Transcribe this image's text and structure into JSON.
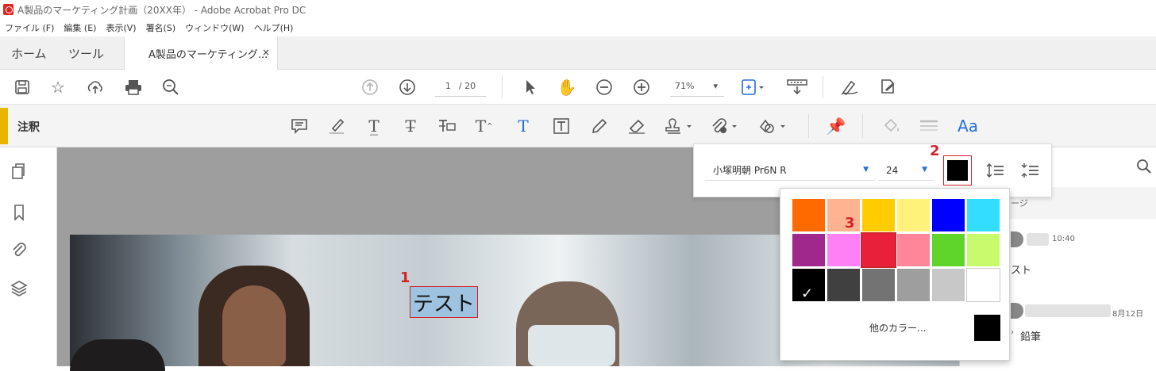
{
  "window": {
    "title": "A製品のマーケティング計画（20XX年） - Adobe Acrobat Pro DC"
  },
  "menu": [
    "ファイル (F)",
    "編集 (E)",
    "表示(V)",
    "署名(S)",
    "ウィンドウ(W)",
    "ヘルプ(H)"
  ],
  "tabs": {
    "home": "ホーム",
    "tools": "ツール",
    "document": "A製品のマーケティング...",
    "close": "×"
  },
  "toolbar": {
    "page_current": "1",
    "page_total": "/ 20",
    "zoom": "71%",
    "zoom_caret": "▾"
  },
  "annotation_bar": {
    "label": "注釈",
    "active_tool": "Aa"
  },
  "text_properties": {
    "font": "小塚明朝 Pr6N R",
    "size": "24",
    "caret": "▼",
    "color": "#000000"
  },
  "palette": {
    "rows": [
      [
        "#ff6a00",
        "#ffb391",
        "#ffcc00",
        "#fff27a",
        "#0000ff",
        "#33ddff"
      ],
      [
        "#a0288c",
        "#ff80f5",
        "#e8203a",
        "#ff8599",
        "#5fd42a",
        "#c8fa6e"
      ],
      [
        "#000000",
        "#404040",
        "#737373",
        "#9e9e9e",
        "#c8c8c8",
        "#ffffff"
      ]
    ],
    "checked": "✓",
    "more_label": "他のカラー...",
    "more_color": "#000000"
  },
  "document": {
    "annotation_text": "テスト"
  },
  "markers": {
    "one": "1",
    "two": "2",
    "three": "3"
  },
  "right_panel": {
    "header_fragment": "ージ",
    "comments": [
      {
        "time": "10:40",
        "text": "スト"
      },
      {
        "time": "8月12日",
        "text": "鉛筆"
      }
    ]
  }
}
